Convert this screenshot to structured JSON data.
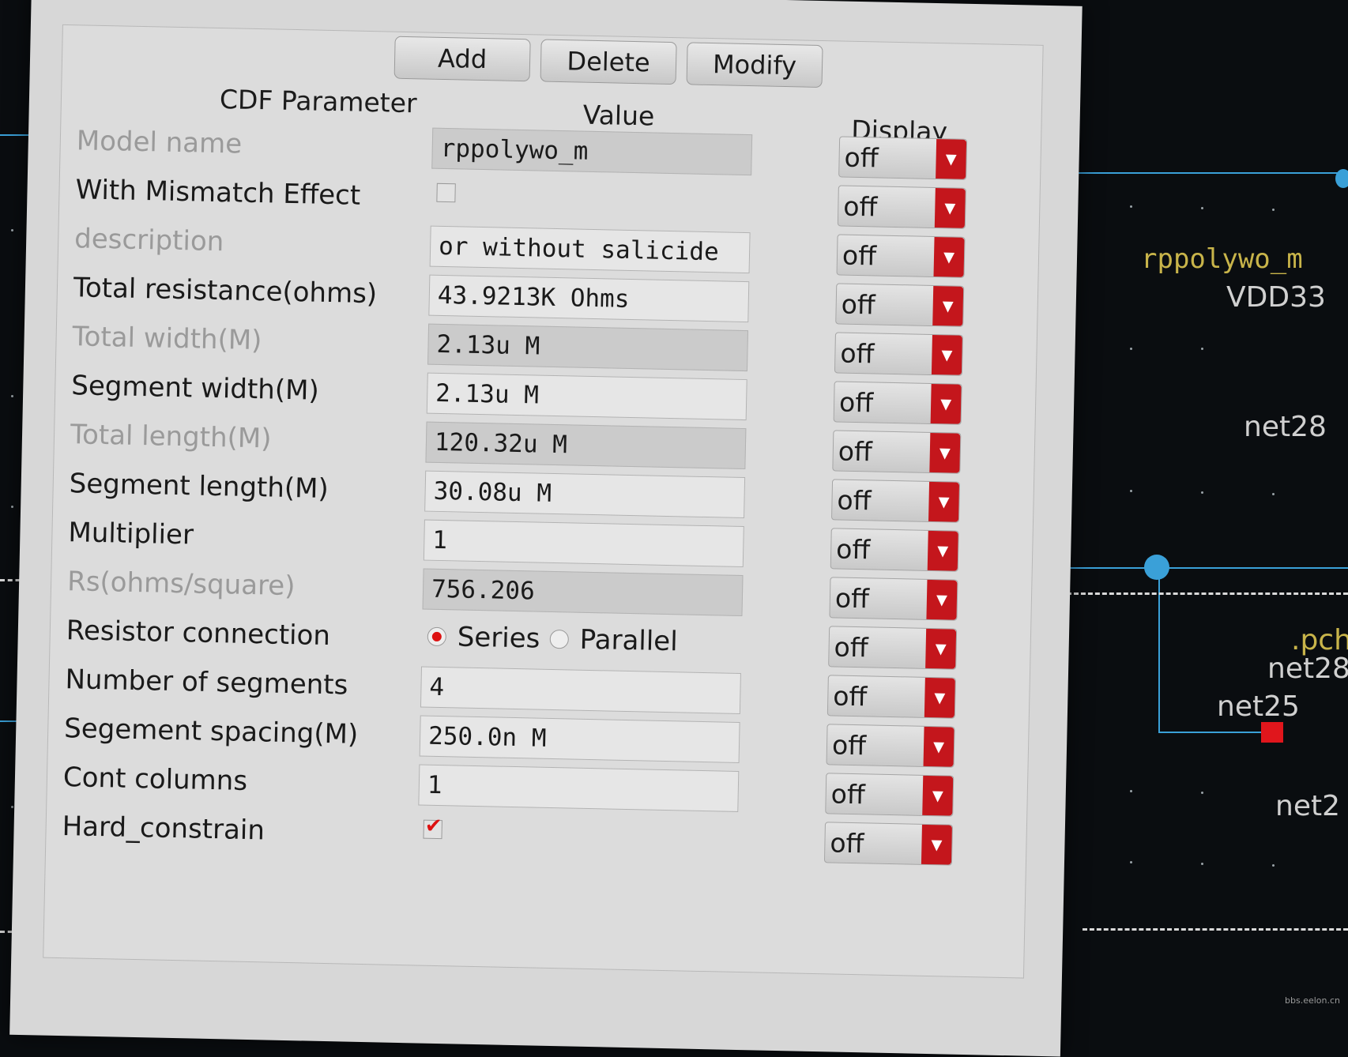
{
  "toolbar": {
    "add_label": "Add",
    "delete_label": "Delete",
    "modify_label": "Modify"
  },
  "headers": {
    "param": "CDF Parameter",
    "value": "Value",
    "display": "Display"
  },
  "rows": [
    {
      "label": "Model name",
      "value": "rppolywo_m",
      "display": "off"
    },
    {
      "label": "With Mismatch Effect",
      "checked": false,
      "display": "off"
    },
    {
      "label": "description",
      "value": "or without salicide",
      "display": "off"
    },
    {
      "label": "Total resistance(ohms)",
      "value": "43.9213K Ohms",
      "display": "off"
    },
    {
      "label": "Total width(M)",
      "value": "2.13u M",
      "display": "off"
    },
    {
      "label": "Segment width(M)",
      "value": "2.13u M",
      "display": "off"
    },
    {
      "label": "Total length(M)",
      "value": "120.32u M",
      "display": "off"
    },
    {
      "label": "Segment length(M)",
      "value": "30.08u M",
      "display": "off"
    },
    {
      "label": "Multiplier",
      "value": "1",
      "display": "off"
    },
    {
      "label": "Rs(ohms/square)",
      "value": "756.206",
      "display": "off"
    },
    {
      "label": "Resistor connection",
      "option1": "Series",
      "option2": "Parallel",
      "selected": "Series",
      "display": "off"
    },
    {
      "label": "Number of segments",
      "value": "4",
      "display": "off"
    },
    {
      "label": "Segement spacing(M)",
      "value": "250.0n M",
      "display": "off"
    },
    {
      "label": "Cont columns",
      "value": "1",
      "display": "off"
    },
    {
      "label": "Hard_constrain",
      "checked": true,
      "display": "off"
    }
  ],
  "schematic": {
    "instance_name": "rppolywo_m",
    "supply": "VDD33",
    "net_a": "net28",
    "net_b": "net28",
    "net_c": "net25",
    "net_d": "net2",
    "pch": ".pch"
  },
  "watermark": "bbs.eelon.cn",
  "colors": {
    "accent": "#c4161c",
    "schematic_wire": "#3aa0d8",
    "schematic_label": "#c8b44a"
  }
}
